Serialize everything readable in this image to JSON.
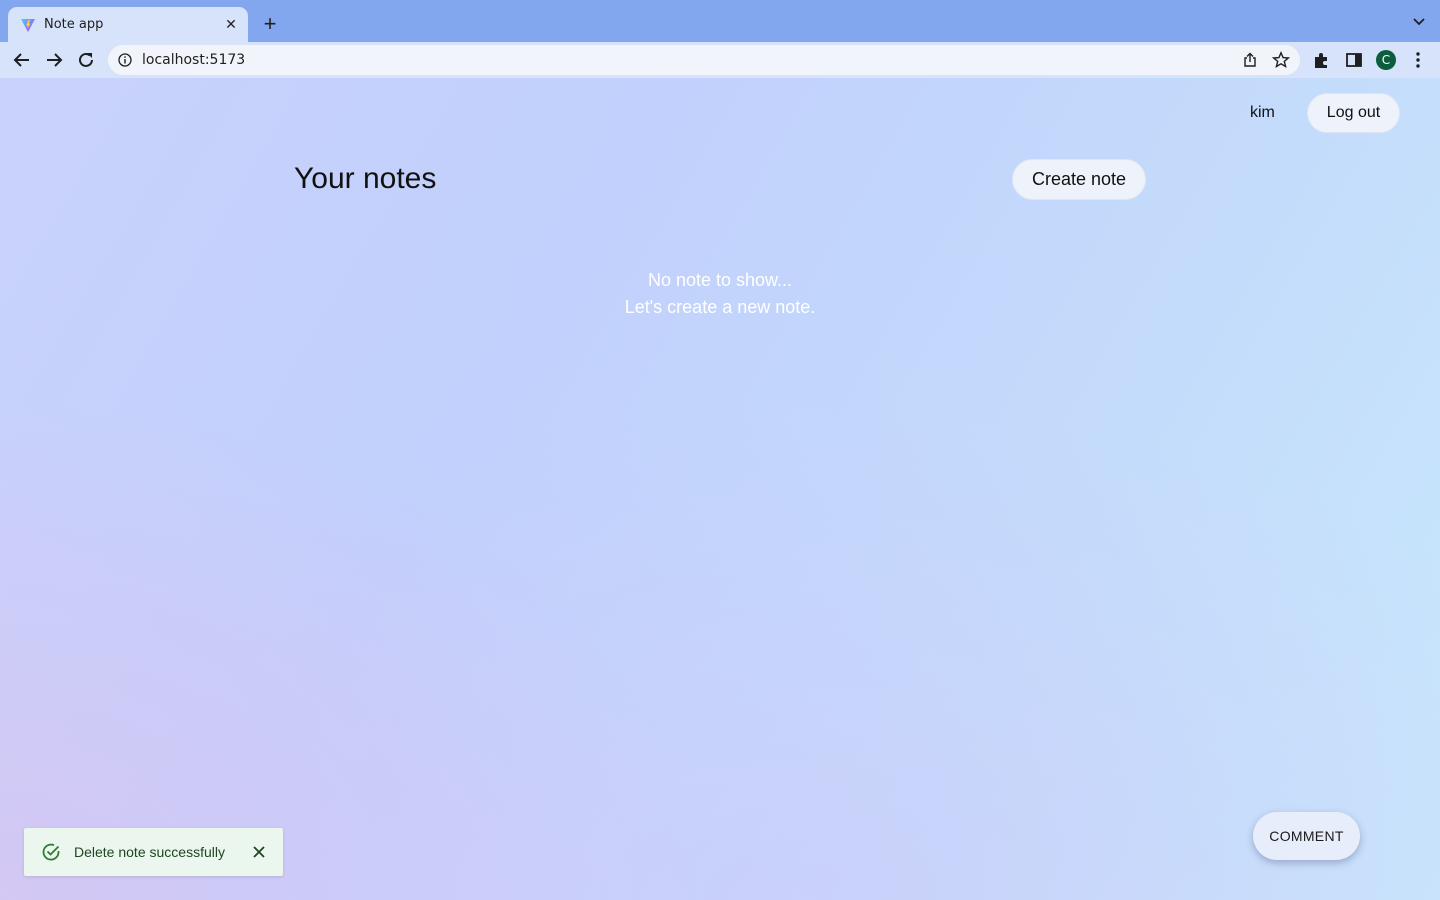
{
  "browser": {
    "tab_title": "Note app",
    "url": "localhost:5173",
    "profile_initial": "C"
  },
  "header": {
    "username": "kim",
    "logout_label": "Log out"
  },
  "main": {
    "title": "Your notes",
    "create_label": "Create note",
    "empty_line1": "No note to show...",
    "empty_line2": "Let's create a new note."
  },
  "comment_label": "COMMENT",
  "toast": {
    "message": "Delete note successfully",
    "status_color": "#2e7d32"
  },
  "icons": [
    "vite-favicon",
    "close-icon",
    "plus-icon",
    "chevron-down-icon",
    "back-icon",
    "forward-icon",
    "reload-icon",
    "info-icon",
    "share-icon",
    "star-icon",
    "extensions-icon",
    "sidepanel-icon",
    "kebab-menu-icon",
    "check-circle-icon"
  ]
}
